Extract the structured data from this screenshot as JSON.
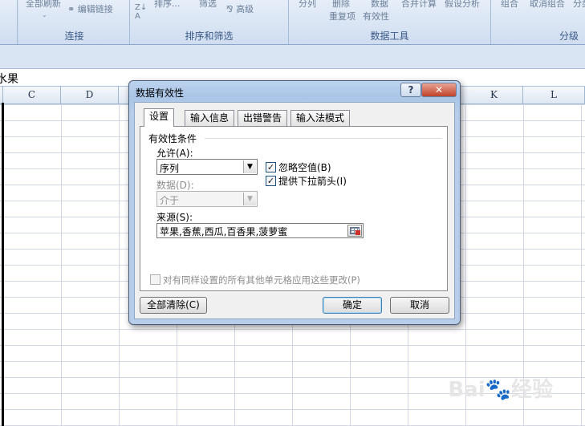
{
  "ribbon": {
    "groups": [
      {
        "title": "连接",
        "buttons": [
          "全部刷新",
          "编辑链接"
        ]
      },
      {
        "title": "排序和筛选",
        "buttons": [
          "排序...",
          "筛选",
          "高级"
        ]
      },
      {
        "title": "数据工具",
        "buttons": [
          "分列",
          "删除",
          "数据",
          "合并计算",
          "假设分析",
          "重复项",
          "有效性"
        ]
      },
      {
        "title": "分级",
        "buttons": [
          "组合",
          "取消组合",
          "分类"
        ]
      }
    ]
  },
  "formula_bar": {
    "content": "水果"
  },
  "columns": [
    "C",
    "D",
    "K",
    "L"
  ],
  "dialog": {
    "title": "数据有效性",
    "help_label": "?",
    "close_label": "✕",
    "tabs": [
      "设置",
      "输入信息",
      "出错警告",
      "输入法模式"
    ],
    "section_title": "有效性条件",
    "allow_label": "允许(A):",
    "allow_value": "序列",
    "data_label": "数据(D):",
    "data_value": "介于",
    "ignore_blank_label": "忽略空值(B)",
    "ignore_blank_checked": true,
    "dropdown_arrow_label": "提供下拉箭头(I)",
    "dropdown_arrow_checked": true,
    "source_label": "来源(S):",
    "source_value": "苹果,香蕉,西瓜,百香果,菠萝蜜",
    "apply_all_label": "对有同样设置的所有其他单元格应用这些更改(P)",
    "apply_all_checked": false,
    "clear_all_label": "全部清除(C)",
    "ok_label": "确定",
    "cancel_label": "取消"
  },
  "watermark": {
    "text": "Bai",
    "suffix": "经验"
  }
}
